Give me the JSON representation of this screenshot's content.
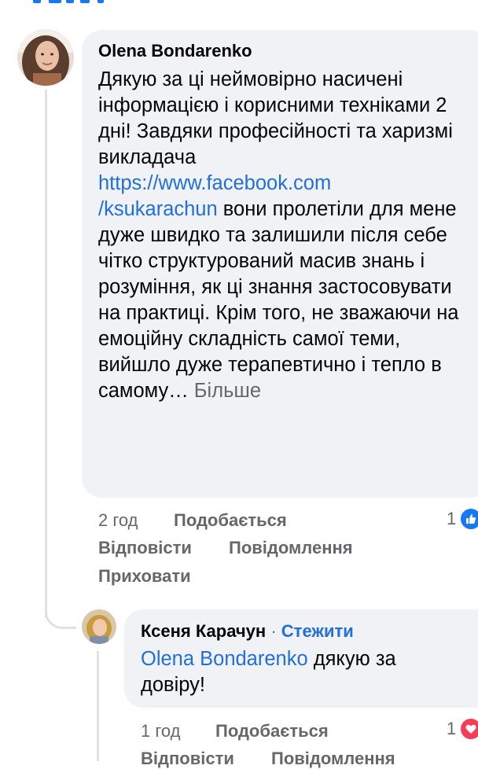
{
  "comment": {
    "author": "Olena Bondarenko",
    "text_before_link": "Дякую за ці неймовірно насичені інформацією і корисними техніками 2 дні! Завдяки професійності та харизмі викладача",
    "link_line1": "https://www.facebook.com",
    "link_line2": "/ksukarachun",
    "text_after_link": " вони  пролетіли для мене дуже швидко та залишили після себе чітко структурований масив знань і розуміння, як ці знання застосовувати на практиці. Крім того, не зважаючи на емоційну складність самої теми, вийшло дуже терапевтично і тепло в самому…",
    "see_more": " Більше",
    "time": "2 год",
    "like_label": "Подобається",
    "reply_label": "Відповісти",
    "message_label": "Повідомлення",
    "hide_label": "Приховати",
    "reaction_count": "1",
    "reaction_icon": "like-icon",
    "reaction_color": "#1877f2"
  },
  "reply": {
    "author": "Ксеня Карачун",
    "separator": "·",
    "follow_label": "Стежити",
    "mention": "Olena Bondarenko",
    "text": " дякую за довіру!",
    "time": "1 год",
    "like_label": "Подобається",
    "reply_label": "Відповісти",
    "message_label": "Повідомлення",
    "reaction_count": "1",
    "reaction_icon": "heart-icon",
    "reaction_color": "#f33e58"
  }
}
